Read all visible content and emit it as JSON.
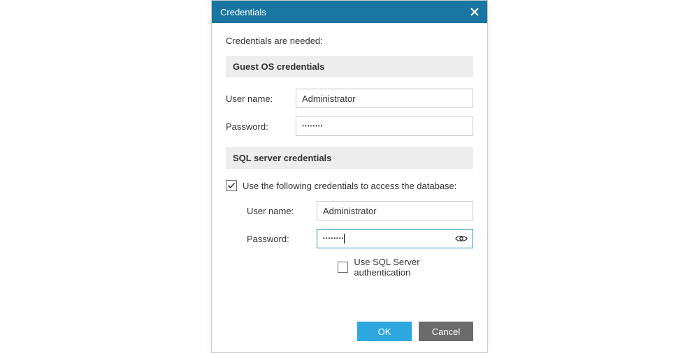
{
  "dialog": {
    "title": "Credentials",
    "intro": "Credentials are needed:",
    "sections": {
      "guest_os": {
        "header": "Guest OS credentials",
        "username_label": "User name:",
        "username_value": "Administrator",
        "password_label": "Password:",
        "password_mask": "••••••••"
      },
      "sql_server": {
        "header": "SQL server credentials",
        "use_creds_checked": true,
        "use_creds_label": "Use the following credentials to access the database:",
        "username_label": "User name:",
        "username_value": "Administrator",
        "password_label": "Password:",
        "password_mask": "••••••••",
        "password_focused": true,
        "sql_auth_checked": false,
        "sql_auth_label": "Use SQL Server authentication"
      }
    },
    "buttons": {
      "ok": "OK",
      "cancel": "Cancel"
    }
  }
}
